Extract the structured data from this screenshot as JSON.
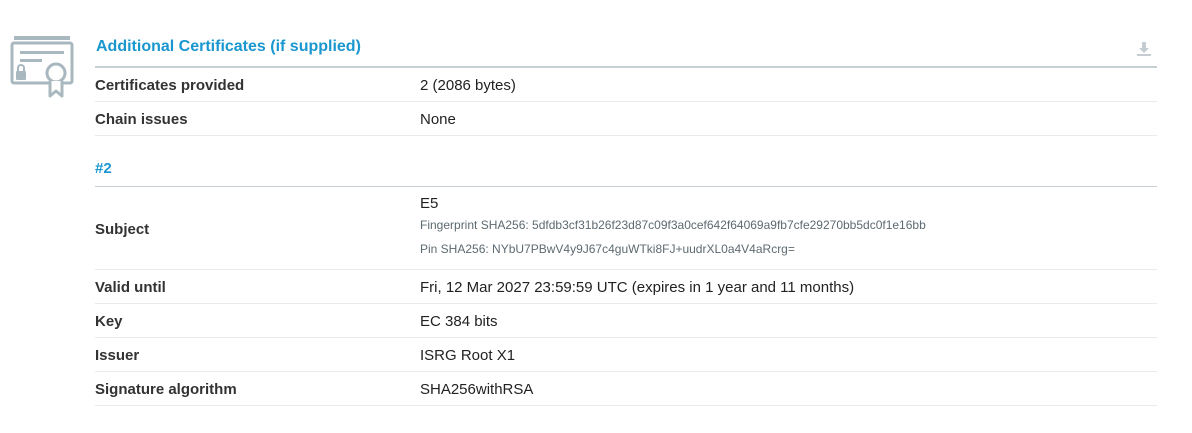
{
  "section": {
    "title": "Additional Certificates (if supplied)",
    "icon": "certificate-icon",
    "action_icon": "download-icon"
  },
  "summary_rows": [
    {
      "label": "Certificates provided",
      "value": "2 (2086 bytes)"
    },
    {
      "label": "Chain issues",
      "value": "None"
    }
  ],
  "certificate": {
    "number_label": "#2",
    "subject": {
      "label": "Subject",
      "name": "E5",
      "fingerprint": "Fingerprint SHA256: 5dfdb3cf31b26f23d87c09f3a0cef642f64069a9fb7cfe29270bb5dc0f1e16bb",
      "pin": "Pin SHA256: NYbU7PBwV4y9J67c4guWTki8FJ+uudrXL0a4V4aRcrg="
    },
    "rows": [
      {
        "label": "Valid until",
        "value": "Fri, 12 Mar 2027 23:59:59 UTC (expires in 1 year and 11 months)"
      },
      {
        "label": "Key",
        "value": "EC 384 bits"
      },
      {
        "label": "Issuer",
        "value": "ISRG Root X1"
      },
      {
        "label": "Signature algorithm",
        "value": "SHA256withRSA"
      }
    ]
  },
  "colors": {
    "accent": "#1a97cf",
    "icon_gray": "#a9b8bf",
    "divider": "#c5cfd4"
  }
}
